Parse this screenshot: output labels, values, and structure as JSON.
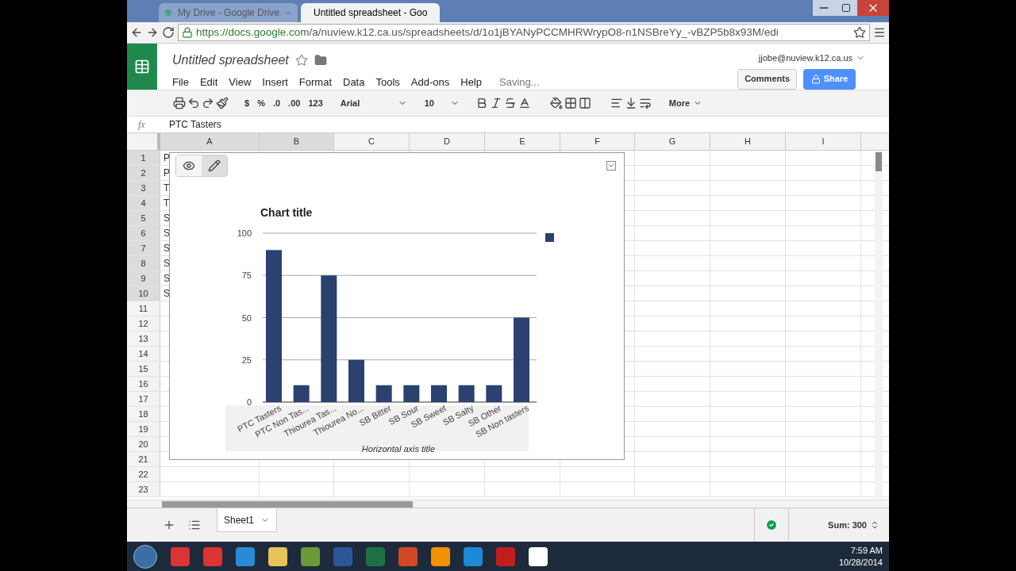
{
  "browser": {
    "tabs": [
      {
        "title": "My Drive - Google Drive",
        "selected": false
      },
      {
        "title": "Untitled spreadsheet - Goo",
        "selected": true
      }
    ],
    "url_host": "https://docs.google.com",
    "url_path": "/a/nuview.k12.ca.us/spreadsheets/d/1o1jBYANyPCCMHRWrypO8-n1NSBreYy_-vBZP5b8x93M/edi"
  },
  "doc": {
    "title": "Untitled spreadsheet",
    "menu": [
      "File",
      "Edit",
      "View",
      "Insert",
      "Format",
      "Data",
      "Tools",
      "Add-ons",
      "Help"
    ],
    "status": "Saving...",
    "account": "jjobe@nuview.k12.ca.us",
    "comments": "Comments",
    "share": "Share"
  },
  "toolbar": {
    "currency": "$",
    "percent": "%",
    "decrease_decimals": ".0",
    "increase_decimals": ".00",
    "number_format": "123",
    "font": "Arial",
    "size": "10",
    "more": "More"
  },
  "formula_bar": {
    "label": "fx",
    "content": "PTC Tasters"
  },
  "grid": {
    "columns": [
      {
        "label": "A",
        "selected": true
      },
      {
        "label": "B",
        "selected": true
      },
      {
        "label": "C",
        "selected": false
      },
      {
        "label": "D",
        "selected": false
      },
      {
        "label": "E",
        "selected": false
      },
      {
        "label": "F",
        "selected": false
      },
      {
        "label": "G",
        "selected": false
      },
      {
        "label": "H",
        "selected": false
      },
      {
        "label": "I",
        "selected": false
      }
    ],
    "rows": [
      {
        "label": "1",
        "selected": true,
        "column_A": "P"
      },
      {
        "label": "2",
        "selected": true,
        "column_A": "P"
      },
      {
        "label": "3",
        "selected": true,
        "column_A": "T"
      },
      {
        "label": "4",
        "selected": true,
        "column_A": "T"
      },
      {
        "label": "5",
        "selected": true,
        "column_A": "S"
      },
      {
        "label": "6",
        "selected": true,
        "column_A": "S"
      },
      {
        "label": "7",
        "selected": true,
        "column_A": "S"
      },
      {
        "label": "8",
        "selected": true,
        "column_A": "S"
      },
      {
        "label": "9",
        "selected": true,
        "column_A": "S"
      },
      {
        "label": "10",
        "selected": true,
        "column_A": "S"
      },
      {
        "label": "11",
        "selected": false
      },
      {
        "label": "12",
        "selected": false
      },
      {
        "label": "13",
        "selected": false
      },
      {
        "label": "14",
        "selected": false
      },
      {
        "label": "15",
        "selected": false
      },
      {
        "label": "16",
        "selected": false
      },
      {
        "label": "17",
        "selected": false
      },
      {
        "label": "18",
        "selected": false
      },
      {
        "label": "19",
        "selected": false
      },
      {
        "label": "20",
        "selected": false
      },
      {
        "label": "21",
        "selected": false
      },
      {
        "label": "22",
        "selected": false
      },
      {
        "label": "23",
        "selected": false
      }
    ]
  },
  "chart": {
    "chart_data": {
      "type": "bar",
      "title": "Chart title",
      "xlabel": "Horizontal axis title",
      "categories": [
        "PTC Tasters",
        "PTC Non Tas...",
        "Thiourea Tas...",
        "Thiourea No...",
        "SB Bitter",
        "SB Sour",
        "SB Sweet",
        "SB Salty",
        "SB Other",
        "SB Non tasters"
      ],
      "series": [
        {
          "color": "#2b4170",
          "values": [
            90,
            10,
            75,
            25,
            10,
            10,
            10,
            10,
            10,
            50
          ]
        }
      ],
      "ylim": [
        0,
        100
      ],
      "grid": true,
      "yticks": [
        0,
        25,
        50,
        75,
        100
      ]
    }
  },
  "sheets": [
    {
      "name": "Sheet1",
      "selected": true
    }
  ],
  "sum": "Sum: 300",
  "taskbar": {
    "time": "7:59 AM",
    "date": "10/28/2014"
  }
}
